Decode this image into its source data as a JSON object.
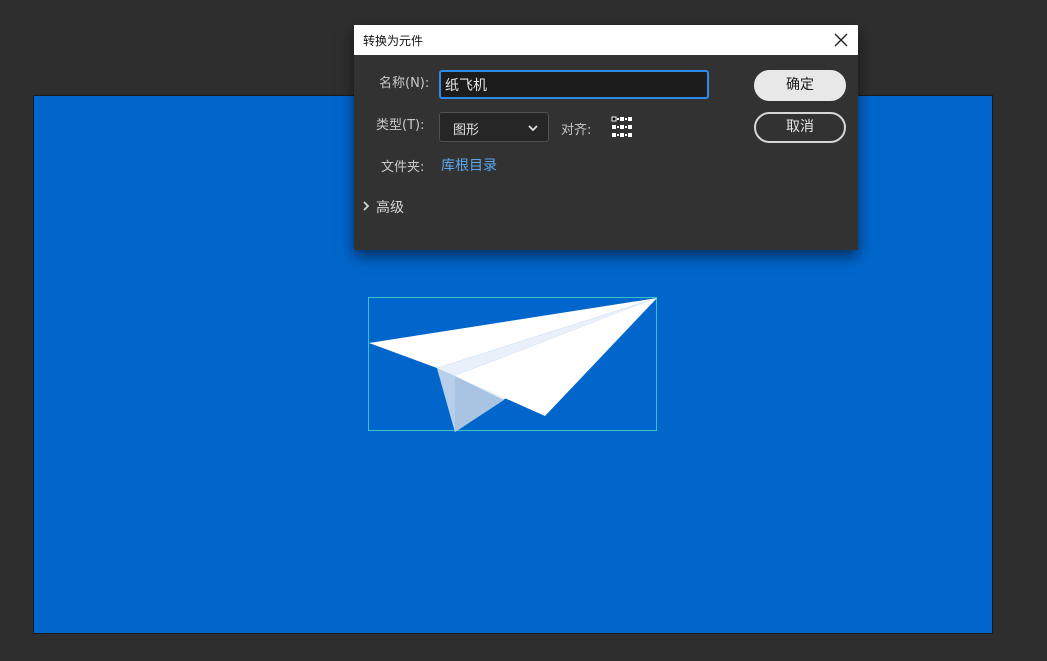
{
  "dialog": {
    "title": "转换为元件",
    "name_label": "名称(N):",
    "name_value": "纸飞机",
    "type_label": "类型(T):",
    "type_value": "图形",
    "align_label": "对齐:",
    "folder_label": "文件夹:",
    "folder_value": "库根目录",
    "advanced_label": "高级",
    "ok_label": "确定",
    "cancel_label": "取消"
  },
  "icons": [
    "close-icon",
    "chevron-down-icon",
    "registration-grid-icon",
    "chevron-right-icon"
  ],
  "colors": {
    "stage": "#0066cc",
    "workspace": "#2e2e2e",
    "dialog": "#323232",
    "accent": "#2d8ceb",
    "link": "#5aa7ee",
    "selection": "#35c4c4"
  }
}
